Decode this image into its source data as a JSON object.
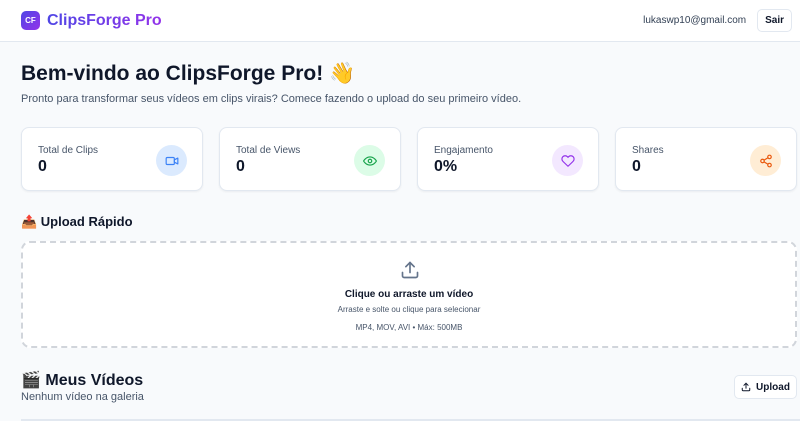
{
  "header": {
    "logo_text": "CF",
    "app_name": "ClipsForge Pro",
    "user_email": "lukaswp10@gmail.com",
    "logout_label": "Sair"
  },
  "welcome": {
    "title": "Bem-vindo ao ClipsForge Pro! 👋",
    "subtitle": "Pronto para transformar seus vídeos em clips virais? Comece fazendo o upload do seu primeiro vídeo."
  },
  "stats": [
    {
      "label": "Total de Clips",
      "value": "0",
      "icon": "video-icon",
      "color": "#3b82f6",
      "bg": "#dbeafe"
    },
    {
      "label": "Total de Views",
      "value": "0",
      "icon": "eye-icon",
      "color": "#16a34a",
      "bg": "#dcfce7"
    },
    {
      "label": "Engajamento",
      "value": "0%",
      "icon": "heart-icon",
      "color": "#9333ea",
      "bg": "#f3e8ff"
    },
    {
      "label": "Shares",
      "value": "0",
      "icon": "share-icon",
      "color": "#ea580c",
      "bg": "#ffedd5"
    }
  ],
  "upload": {
    "section_title": "📤 Upload Rápido",
    "drop_title": "Clique ou arraste um vídeo",
    "drop_subtitle": "Arraste e solte ou clique para selecionar",
    "drop_formats": "MP4, MOV, AVI • Máx: 500MB"
  },
  "videos": {
    "section_title": "🎬 Meus Vídeos",
    "empty_text": "Nenhum vídeo na galeria",
    "upload_button": "Upload"
  }
}
